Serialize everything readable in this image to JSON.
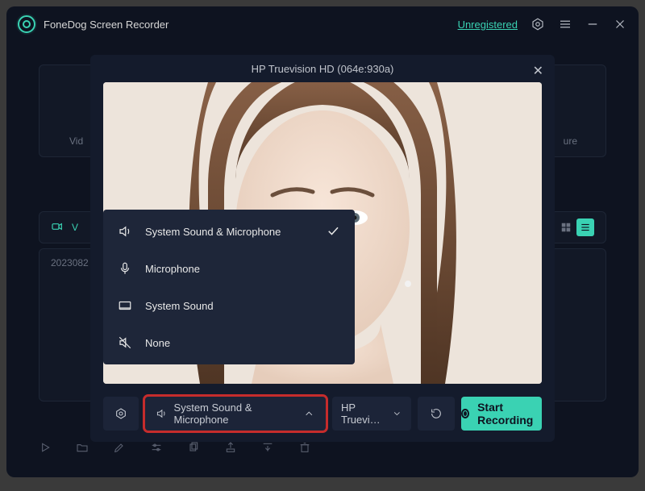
{
  "app": {
    "title": "FoneDog Screen Recorder",
    "unregistered_label": "Unregistered"
  },
  "background": {
    "left_label": "Vid",
    "right_label": "ure",
    "tab_letter": "V",
    "list_item_prefix": "2023082"
  },
  "modal": {
    "title": "HP Truevision HD (064e:930a)",
    "audio_options": [
      "System Sound & Microphone",
      "Microphone",
      "System Sound",
      "None"
    ],
    "audio_selected": "System Sound & Microphone",
    "device_selected": "HP Truevi…",
    "start_label": "Start Recording"
  }
}
